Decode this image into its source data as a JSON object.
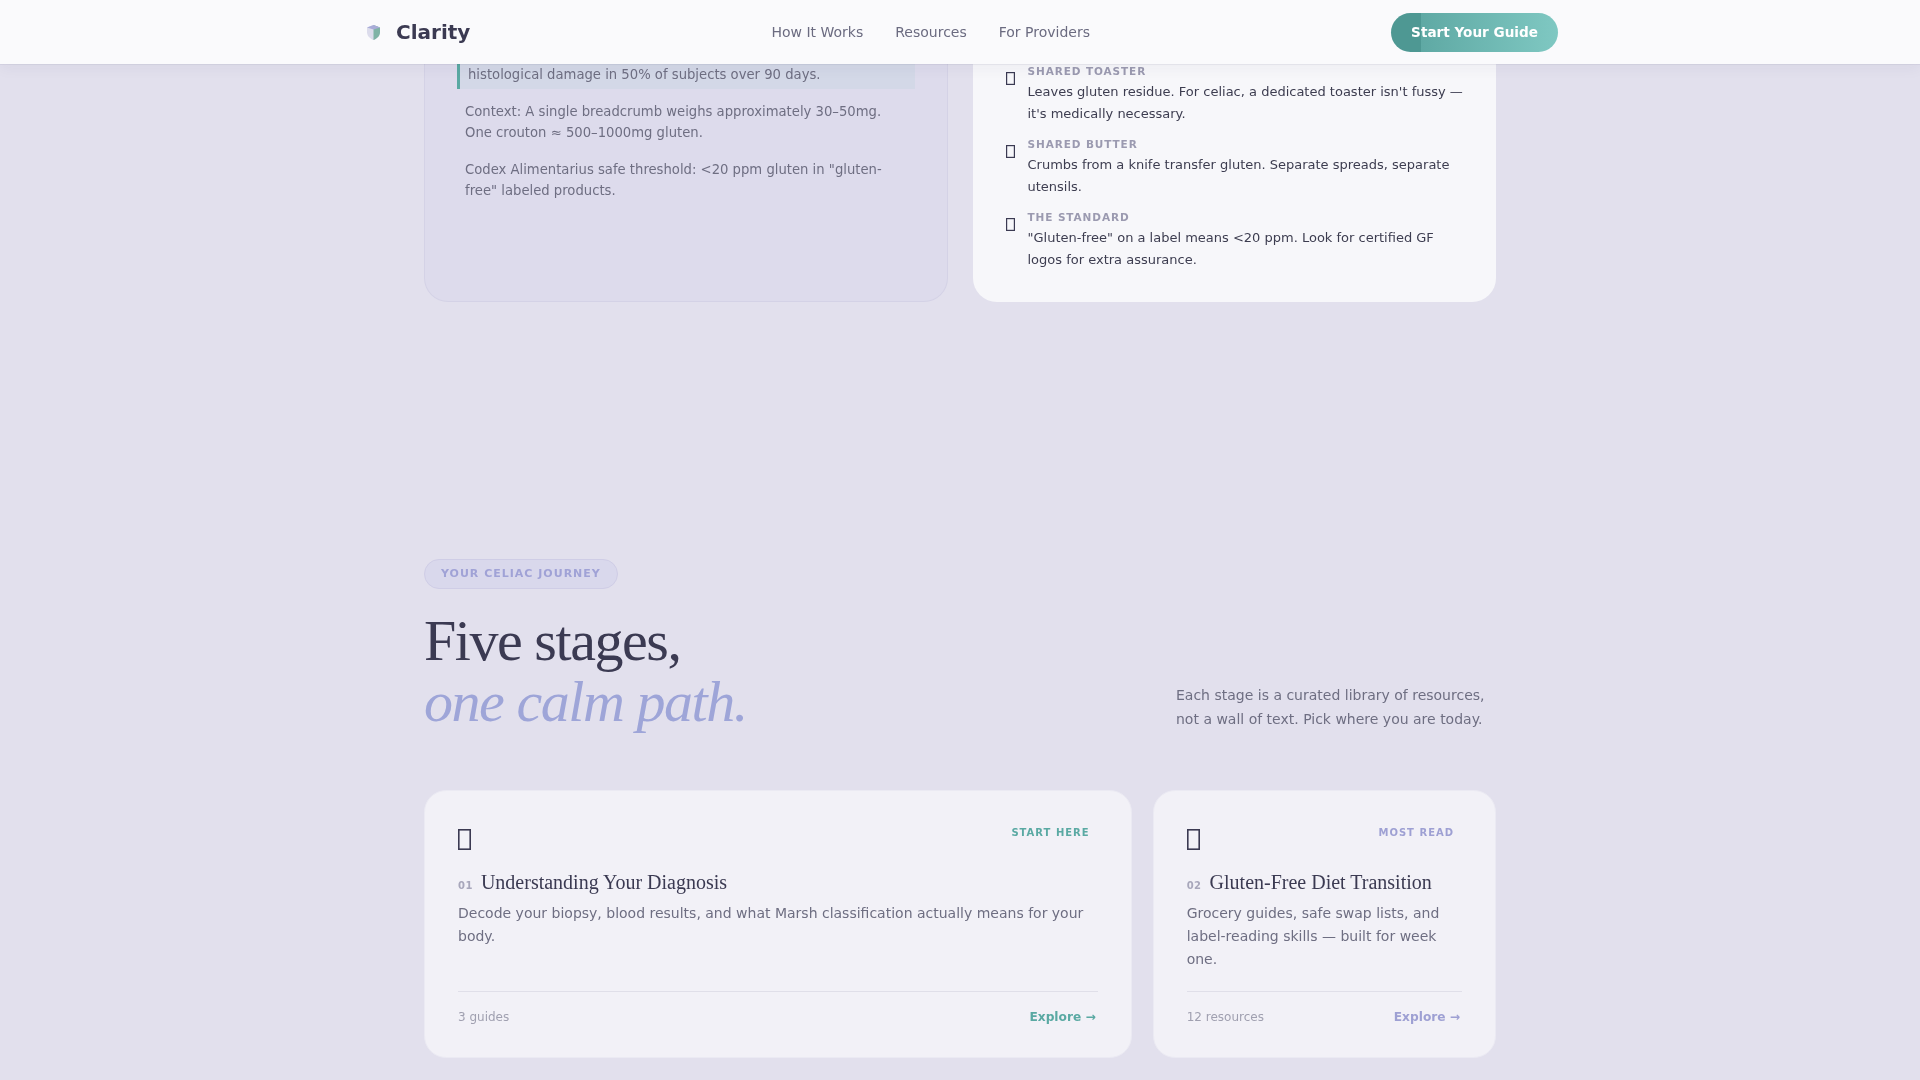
{
  "nav": {
    "brand": "Clarity",
    "links": [
      {
        "label": "How It Works"
      },
      {
        "label": "Resources"
      },
      {
        "label": "For Providers"
      }
    ],
    "cta": "Start Your Guide"
  },
  "evidence_panel": {
    "callout": "histological damage in 50% of subjects over 90 days.",
    "notes": [
      "Context: A single breadcrumb weighs approximately 30–50mg. One crouton ≈ 500–1000mg gluten.",
      "Codex Alimentarius safe threshold: <20 ppm gluten in \"gluten-free\" labeled products."
    ]
  },
  "kitchen_panel": {
    "items": [
      {
        "label": "SHARED TOASTER",
        "text": "Leaves gluten residue. For celiac, a dedicated toaster isn't fussy — it's medically necessary."
      },
      {
        "label": "SHARED BUTTER",
        "text": "Crumbs from a knife transfer gluten. Separate spreads, separate utensils."
      },
      {
        "label": "THE STANDARD",
        "text": "\"Gluten-free\" on a label means <20 ppm. Look for certified GF logos for extra assurance."
      }
    ]
  },
  "journey": {
    "eyebrow": "YOUR CELIAC JOURNEY",
    "heading": "Five stages,",
    "heading_accent": "one calm path.",
    "intro": "Each stage is a curated library of resources, not a wall of text. Pick where you are today.",
    "stages": [
      {
        "number": "01",
        "title": "Understanding Your Diagnosis",
        "tag": "START HERE",
        "description": "Decode your biopsy, blood results, and what Marsh classification actually means for your body.",
        "count": "3 guides",
        "link": "Explore →",
        "color": "#5aa9a3"
      },
      {
        "number": "02",
        "title": "Gluten-Free Diet Transition",
        "tag": "MOST READ",
        "description": "Grocery guides, safe swap lists, and label-reading skills — built for week one.",
        "count": "12 resources",
        "link": "Explore →",
        "color": "#9ea0d3"
      }
    ]
  }
}
